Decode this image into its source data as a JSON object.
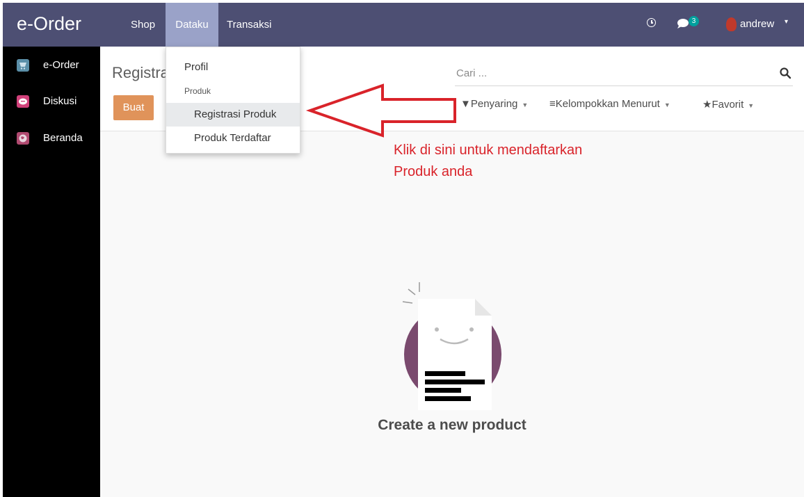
{
  "app": {
    "brand": "e-Order"
  },
  "nav": {
    "items": [
      "Shop",
      "Dataku",
      "Transaksi"
    ]
  },
  "systray": {
    "chat_count": "3",
    "user_name": "andrew"
  },
  "sidebar": {
    "items": [
      {
        "label": "e-Order",
        "icon": "cart-icon",
        "color": "#5b8fa8"
      },
      {
        "label": "Diskusi",
        "icon": "chat-icon",
        "color": "#d1417a"
      },
      {
        "label": "Beranda",
        "icon": "globe-icon",
        "color": "#b04a70"
      }
    ]
  },
  "control": {
    "breadcrumb": "Registrasi Produk",
    "create_label": "Buat",
    "search_placeholder": "Cari ...",
    "filters": {
      "filter": "Penyaring",
      "group_by": "Kelompokkan Menurut",
      "favorites": "Favorit"
    }
  },
  "dropdown": {
    "profile": "Profil",
    "section_header": "Produk",
    "registration": "Registrasi Produk",
    "registered": "Produk Terdaftar"
  },
  "annotation": {
    "line1": "Klik di sini untuk mendaftarkan",
    "line2": "Produk anda"
  },
  "empty_state": {
    "title": "Create a new product"
  },
  "colors": {
    "topbar": "#4d4f73",
    "active_menu": "#9aa2c8",
    "create_button": "#e0935a",
    "annotation": "#d9232a",
    "illustration_circle": "#7a4a6e"
  }
}
